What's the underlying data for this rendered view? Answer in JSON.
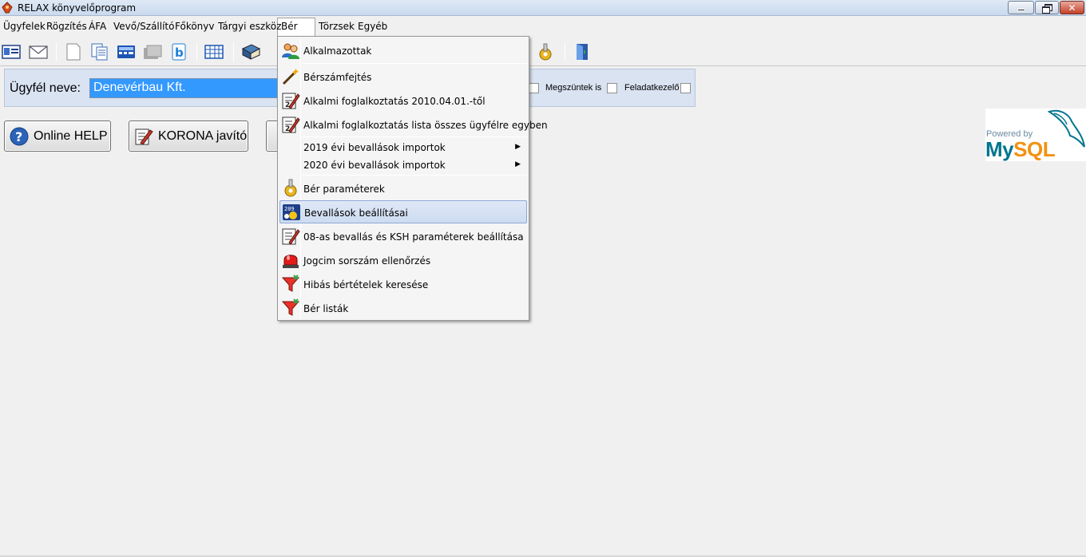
{
  "window": {
    "title": "RELAX könyvelőprogram"
  },
  "menubar": {
    "items": [
      "Ügyfelek",
      "Rögzítés",
      "ÁFA",
      "Vevő/Szállító",
      "Főkönyv",
      "Tárgyi eszköz",
      "Bér",
      "Törzsek",
      "Egyéb"
    ]
  },
  "client": {
    "label": "Ügyfél neve:",
    "value": "Denevérbau Kft.",
    "checkbox_megszuntek": "Megszüntek is",
    "checkbox_feladatkezelo": "Feladatkezelő"
  },
  "buttons": {
    "help": "Online HELP",
    "korona": "KORONA javító"
  },
  "logo": {
    "powered": "Powered by",
    "my": "My",
    "sql": "SQL"
  },
  "dropdown": {
    "items": [
      {
        "label": "Alkalmazottak",
        "icon": "people-icon"
      },
      {
        "label": "Bérszámfejtés",
        "icon": "magic-wand-icon"
      },
      {
        "label": "Alkalmi foglalkoztatás 2010.04.01.-től",
        "icon": "edit-document-icon"
      },
      {
        "label": "Alkalmi foglalkoztatás lista összes ügyfélre egyben",
        "icon": "edit-document-icon"
      },
      {
        "label": "2019 évi bevallások importok",
        "icon": "",
        "submenu": true
      },
      {
        "label": "2020 évi bevallások importok",
        "icon": "",
        "submenu": true
      },
      {
        "label": "Bér paraméterek",
        "icon": "gear-hand-icon"
      },
      {
        "label": "Bevallások beállításai",
        "icon": "settings-screen-icon",
        "highlighted": true
      },
      {
        "label": "08-as bevallás és KSH paraméterek beállítása",
        "icon": "edit-document-icon"
      },
      {
        "label": "Jogcim sorszám ellenőrzés",
        "icon": "red-alarm-icon"
      },
      {
        "label": "Hibás bértételek keresése",
        "icon": "filter-icon"
      },
      {
        "label": "Bér listák",
        "icon": "filter-icon"
      }
    ]
  }
}
